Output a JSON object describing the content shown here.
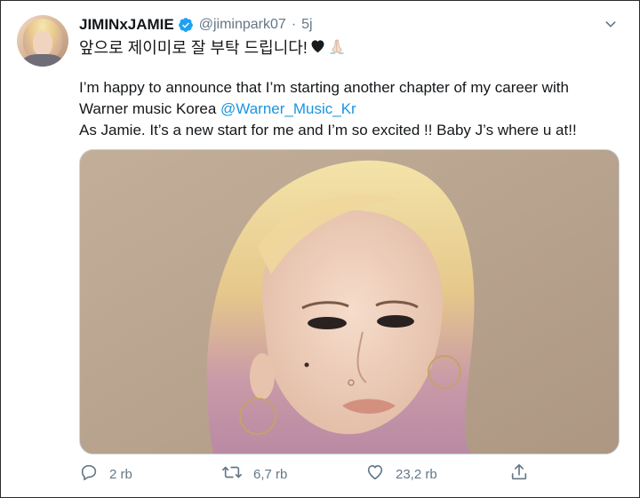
{
  "tweet": {
    "display_name": "JIMINxJAMIE",
    "handle": "@jiminpark07",
    "separator": "·",
    "time": "5j",
    "korean_line": "앞으로 제이미로 잘 부탁 드립니다!",
    "emojis": [
      "black-heart",
      "folded-hands"
    ],
    "para1_line1": "I’m happy to announce that I’m starting another chapter of my career with",
    "para1_line2_prefix": "Warner music Korea ",
    "mention": "@Warner_Music_Kr",
    "para1_line3": "As Jamie. It’s a new start for me and I’m so excited !! Baby J’s where u at!!"
  },
  "actions": {
    "reply_count": "2 rb",
    "retweet_count": "6,7 rb",
    "like_count": "23,2 rb"
  },
  "icons": {
    "verified": "verified-badge-icon",
    "menu": "chevron-down-icon",
    "reply": "reply-icon",
    "retweet": "retweet-icon",
    "like": "like-icon",
    "share": "share-icon"
  },
  "colors": {
    "accent": "#1da1f2",
    "link": "#1b95e0",
    "muted": "#657786",
    "text": "#14171a"
  }
}
